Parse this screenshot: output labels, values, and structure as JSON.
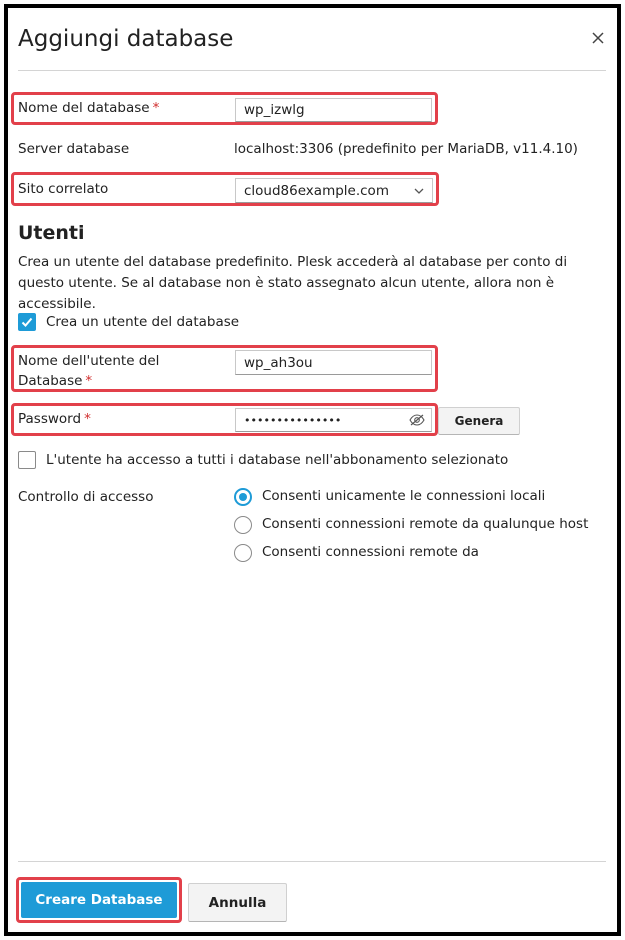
{
  "dialog": {
    "title": "Aggiungi database",
    "close_label": "×"
  },
  "form": {
    "db_name_label": "Nome del database",
    "db_name_value": "wp_izwlg",
    "server_label": "Server database",
    "server_value": "localhost:3306 (predefinito per MariaDB, v11.4.10)",
    "site_label": "Sito correlato",
    "site_value": "cloud86example.com",
    "required_mark": "*"
  },
  "users": {
    "section_title": "Utenti",
    "description": "Crea un utente del database predefinito. Plesk accederà al database per conto di questo utente. Se al database non è stato assegnato alcun utente, allora non è accessibile.",
    "create_user_label": "Crea un utente del database",
    "create_user_checked": true,
    "username_label_line1": "Nome dell'utente del",
    "username_label_line2": "Database",
    "username_value": "wp_ah3ou",
    "password_label": "Password",
    "password_value": "•••••••••••••••",
    "generate_button": "Genera",
    "all_db_access_label": "L'utente ha accesso a tutti i database nell'abbonamento selezionato",
    "all_db_access_checked": false
  },
  "access": {
    "label": "Controllo di accesso",
    "options": [
      {
        "label": "Consenti unicamente le connessioni locali",
        "selected": true
      },
      {
        "label": "Consenti connessioni remote da qualunque host",
        "selected": false
      },
      {
        "label": "Consenti connessioni remote da",
        "selected": false
      }
    ]
  },
  "footer": {
    "create_button": "Creare Database",
    "cancel_button": "Annulla"
  },
  "colors": {
    "accent": "#1e9bd7",
    "highlight": "#e2404a",
    "required": "#d02c2c"
  }
}
